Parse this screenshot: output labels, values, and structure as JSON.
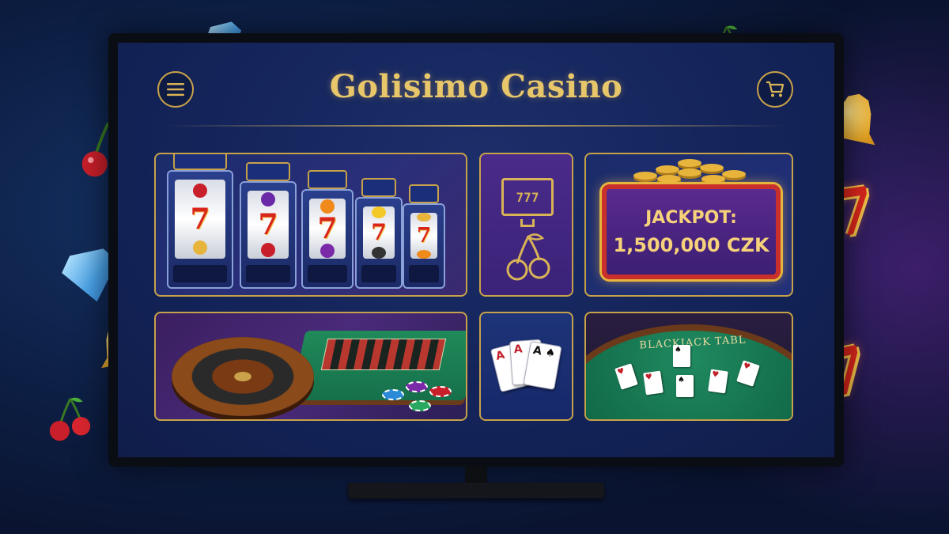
{
  "app": {
    "title": "Golisimo Casino"
  },
  "header": {
    "menu_icon": "hamburger-menu-icon",
    "cart_icon": "shopping-cart-icon"
  },
  "tiles": {
    "slots": {
      "reel_symbol": "7"
    },
    "slot_machine_icon": {
      "reels": "777"
    },
    "jackpot": {
      "label": "JACKPOT:",
      "amount": "1,500,000 CZK"
    },
    "blackjack": {
      "table_text": "BLACKJACK TABL"
    },
    "cards": {
      "ranks": [
        "A",
        "A",
        "A"
      ]
    }
  },
  "decorations": {
    "seven_symbol": "7"
  },
  "colors": {
    "gold_accent": "#c7a24a",
    "title_gold": "#e8c66a",
    "screen_navy": "#14245a",
    "seven_red": "#d8261c",
    "jackpot_purple": "#5a2a8e"
  }
}
